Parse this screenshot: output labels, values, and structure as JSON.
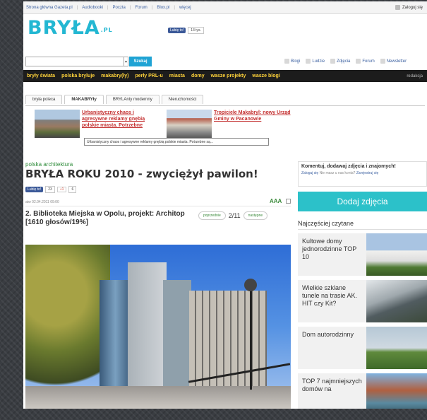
{
  "topbar": {
    "links": [
      "Strona główna Gazeta.pl",
      "Audiobooki",
      "Poczta",
      "Forum",
      "Blox.pl",
      "więcej"
    ],
    "login": "Zaloguj się"
  },
  "logo": {
    "text": "BRYŁA",
    "suffix": ".PL"
  },
  "fb_like": {
    "label": "Lubię to!",
    "count": "13 tys."
  },
  "search": {
    "placeholder": "",
    "button": "Szukaj"
  },
  "toplinks": [
    "Blogi",
    "Ludzie",
    "Zdjęcia",
    "Forum",
    "Newsletter"
  ],
  "nav": {
    "items": [
      "bryły świata",
      "polska bryluje",
      "makabry(ły)",
      "perły PRL-u",
      "miasta",
      "domy",
      "wasze projekty",
      "wasze blogi"
    ],
    "right": "redakcja"
  },
  "tabs": [
    "bryła poleca",
    "MAKABRYły",
    "BRYLAnty modernny",
    "Nieruchomości"
  ],
  "teasers": [
    {
      "title": "Urbanistyczny chaos i agresywne reklamy gnębią polskie miasta. Potrzebne"
    },
    {
      "title": "Tropiciele Makabryl: nowy Urząd Gminy w Pacanowie"
    }
  ],
  "tooltip": "Urbanistyczny chaos i agresywne reklamy gnębią polskie miasta. Potrzebne są...",
  "article": {
    "section": "polska architektura",
    "title": "BRYŁA ROKU 2010 - zwyciężył pawilon!",
    "fb_label": "Lubię to!",
    "fb_count": "23",
    "gplus": "+1",
    "gplus_count": "6",
    "meta": "atw 02.04.2011 09:00",
    "font_size": "AAA",
    "caption": "2. Biblioteka Miejska w Opolu, projekt: Architop [1610 głosów/19%]",
    "pager": {
      "prev": "poprzednie",
      "count": "2/11",
      "next": "następne"
    }
  },
  "right": {
    "comment_title": "Komentuj, dodawaj zdjęcia i znajomych!",
    "login_link": "Zaloguj się",
    "no_account": "Nie masz u nas konta?",
    "register": "Zarejestruj się",
    "add_photo": "Dodaj zdjęcia",
    "popular_title": "Najczęściej czytane",
    "popular": [
      "Kultowe domy jednorodzinne TOP 10",
      "Wielkie szklane tunele na trasie AK. HIT czy Kit?",
      "Dom autorodzinny",
      "TOP 7 najmniejszych domów na"
    ]
  },
  "colors": {
    "accent": "#23b7d2",
    "nav_bg": "#1c1c1c",
    "nav_text": "#ffd33a",
    "add_photo": "#2cc1c9"
  }
}
